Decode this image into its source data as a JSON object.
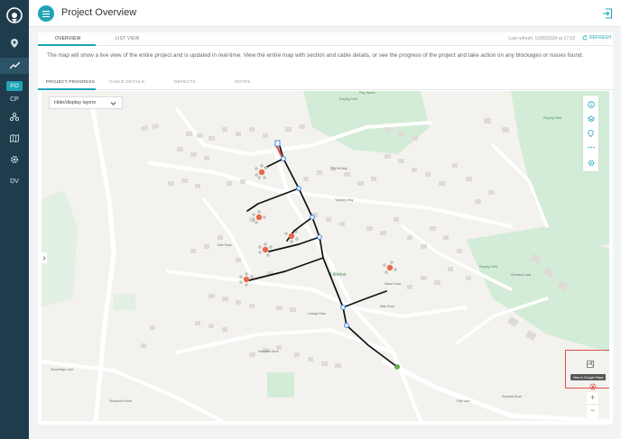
{
  "header": {
    "title": "Project Overview"
  },
  "sidebar": {
    "items": [
      {
        "label": "PO"
      },
      {
        "label": "CP"
      },
      {
        "label": "DV"
      }
    ]
  },
  "top_tabs": [
    {
      "label": "OVERVIEW"
    },
    {
      "label": "LIST VIEW"
    }
  ],
  "refresh": {
    "info": "Last refresh: 13/05/2024 at 17:02",
    "label": "REFRESH"
  },
  "description": "The map will show a live view of the entire project and is updated in real-time. View the entire map with section and cable details, or see the progress of the project and take action on any blockages or issues found.",
  "sub_tabs": [
    {
      "label": "PROJECT PROGRESS"
    },
    {
      "label": "CABLE DETAILS"
    },
    {
      "label": "DEFECTS"
    },
    {
      "label": "NOTES"
    }
  ],
  "map": {
    "layers_dropdown": "Hide/display layers",
    "tooltip": "View in Google Maps",
    "zoom_in": "+",
    "zoom_out": "−",
    "labels": {
      "playing_field_1": "Playing Field",
      "playing_field_2": "Playing Field",
      "playing_field_3": "Playing Field",
      "play_space": "Play Space",
      "village": "Littleton",
      "road_1": "The Hill Way",
      "road_2": "Tydesley Way",
      "road_3": "Cheshunt Lane",
      "road_4": "Dale Road",
      "road_5": "Manor Road",
      "road_6": "Cottage Drive",
      "road_7": "Main Road",
      "road_8": "Park Lane",
      "road_9": "Mansfield Drive",
      "road_10": "Ryebank Road",
      "road_11": "Stourbridge Lane",
      "road_12": "Stockwood Road"
    }
  },
  "colors": {
    "accent": "#1fa4b6",
    "sidebar": "#1f3c4c",
    "route": "#111111",
    "node": "#2d7de0",
    "end_node": "#6ab04c",
    "cluster": "#e46a4b",
    "highlight": "#e0504a",
    "park": "#d3ecd7"
  }
}
